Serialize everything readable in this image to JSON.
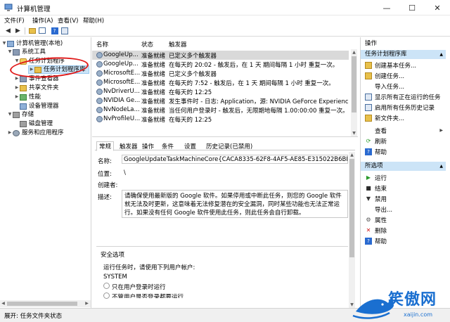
{
  "window": {
    "title": "计算机管理",
    "controls": {
      "minimize": "—",
      "maximize": "☐",
      "close": "✕"
    }
  },
  "menu": [
    "文件(F)",
    "操作(A)",
    "查看(V)",
    "帮助(H)"
  ],
  "toolbar_icons": [
    "back-icon",
    "forward-icon",
    "folder-up-icon",
    "show-tree-icon",
    "help-icon",
    "properties-icon"
  ],
  "tree": [
    {
      "label": "计算机管理(本地)",
      "icon": "computer-icon"
    },
    {
      "label": "系统工具",
      "icon": "tools-icon"
    },
    {
      "label": "任务计划程序",
      "icon": "clock-icon"
    },
    {
      "label": "任务计划程序库",
      "icon": "folder-icon"
    },
    {
      "label": "事件查看器",
      "icon": "event-viewer-icon"
    },
    {
      "label": "共享文件夹",
      "icon": "shared-folder-icon"
    },
    {
      "label": "性能",
      "icon": "performance-icon"
    },
    {
      "label": "设备管理器",
      "icon": "device-manager-icon"
    },
    {
      "label": "存储",
      "icon": "storage-icon"
    },
    {
      "label": "磁盘管理",
      "icon": "disk-icon"
    },
    {
      "label": "服务和应用程序",
      "icon": "services-icon"
    }
  ],
  "task_list": {
    "columns": [
      "名称",
      "状态",
      "触发器"
    ],
    "rows": [
      {
        "name": "GoogleUp...",
        "status": "准备就绪",
        "trigger": "已定义多个触发器"
      },
      {
        "name": "GoogleUp...",
        "status": "准备就绪",
        "trigger": "在每天的 20:02 - 触发后，在 1 天 期间每隔 1 小时 重复一次。"
      },
      {
        "name": "MicrosoftE...",
        "status": "准备就绪",
        "trigger": "已定义多个触发器"
      },
      {
        "name": "MicrosoftE...",
        "status": "准备就绪",
        "trigger": "在每天的 7:52 - 触发后，在 1 天 期间每隔 1 小时 重复一次。"
      },
      {
        "name": "NvDriverU...",
        "status": "准备就绪",
        "trigger": "在每天的 12:25"
      },
      {
        "name": "NVIDIA Ge...",
        "status": "准备就绪",
        "trigger": "发生事件时 - 日志: Application，源: NVIDIA GeForce Experience SelfUp"
      },
      {
        "name": "NvNodeLa...",
        "status": "准备就绪",
        "trigger": "当任何用户登录时 - 触发后，无限期地每隔 1.00:00:00 重复一次。"
      },
      {
        "name": "NvProfileU...",
        "status": "准备就绪",
        "trigger": "在每天的 12:25"
      }
    ]
  },
  "detail": {
    "tabs": [
      "常规",
      "触发器",
      "操作",
      "条件",
      "设置",
      "历史记录(已禁用)"
    ],
    "name_label": "名称:",
    "name_value": "GoogleUpdateTaskMachineCore{CACA8335-62F8-4AF5-AE85-E315022B6BDA}",
    "location_label": "位置:",
    "location_value": "\\",
    "author_label": "创建者:",
    "author_value": "",
    "desc_label": "描述:",
    "desc_value": "请确保使用最新版的 Google 软件。如果停用或中断此任务，则您的 Google 软件就无法及时更新，这意味着无法修复潜在的安全漏洞，同时某些功能也无法正常运行。如果没有任何 Google 软件使用此任务，则此任务会自行卸载。",
    "security_title": "安全选项",
    "run_as_label": "运行任务时，请使用下列用户帐户:",
    "run_as_value": "SYSTEM",
    "option1": "只在用户登录时运行",
    "option2": "不管用户是否登录都要运行"
  },
  "actions": {
    "header": "操作",
    "section1": "任务计划程序库",
    "items1": [
      {
        "label": "创建基本任务...",
        "icon": "create-basic-task-icon"
      },
      {
        "label": "创建任务...",
        "icon": "create-task-icon"
      },
      {
        "label": "导入任务...",
        "icon": "import-task-icon"
      },
      {
        "label": "显示所有正在运行的任务",
        "icon": "running-tasks-icon"
      },
      {
        "label": "启用所有任务历史记录",
        "icon": "history-icon"
      },
      {
        "label": "新文件夹...",
        "icon": "new-folder-icon"
      },
      {
        "label": "查看",
        "icon": "view-icon",
        "submenu": true
      },
      {
        "label": "刷新",
        "icon": "refresh-icon"
      },
      {
        "label": "帮助",
        "icon": "help-icon"
      }
    ],
    "section2": "所选项",
    "items2": [
      {
        "label": "运行",
        "icon": "run-icon"
      },
      {
        "label": "结束",
        "icon": "end-icon"
      },
      {
        "label": "禁用",
        "icon": "disable-icon"
      },
      {
        "label": "导出...",
        "icon": "export-icon"
      },
      {
        "label": "属性",
        "icon": "properties-icon"
      },
      {
        "label": "删除",
        "icon": "delete-icon"
      },
      {
        "label": "帮助",
        "icon": "help-icon"
      }
    ]
  },
  "status_bar": "展开: 任务文件夹状态",
  "watermark": {
    "text": "笑傲网",
    "sub": "xaijin.com"
  },
  "colors": {
    "selection": "#cce4f7",
    "annotation_red": "#e01818",
    "watermark_blue": "#1a6fd0"
  }
}
